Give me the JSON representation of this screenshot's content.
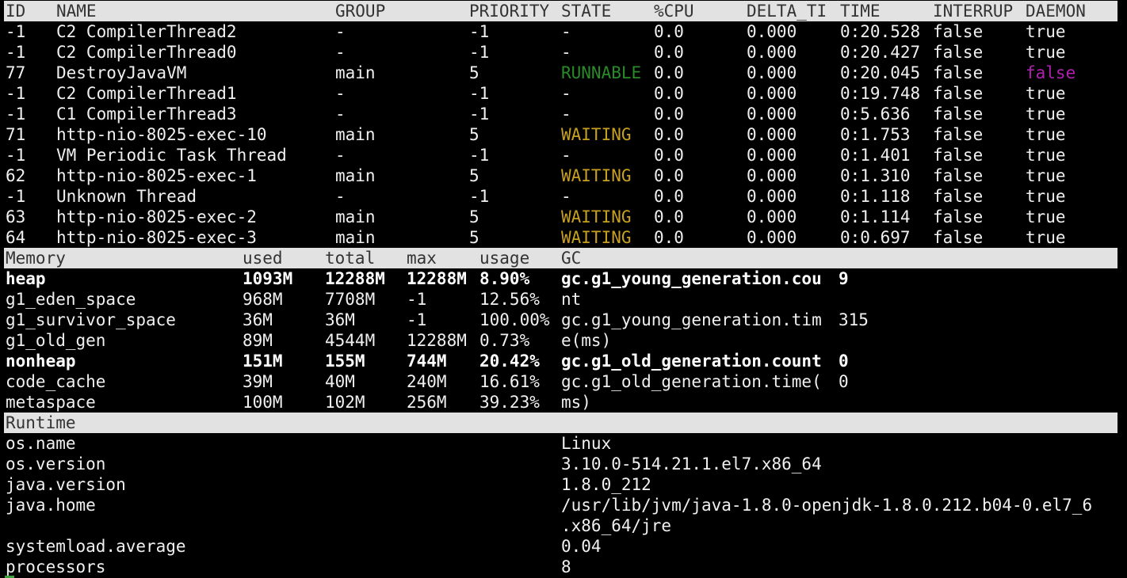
{
  "threads": {
    "headers": [
      "ID",
      "NAME",
      "GROUP",
      "PRIORITY",
      "STATE",
      "%CPU",
      "DELTA_TI",
      "TIME",
      "INTERRUP",
      "DAEMON"
    ],
    "rows": [
      [
        "-1",
        "C2 CompilerThread2",
        "-",
        "-1",
        "-",
        "0.0",
        "0.000",
        "0:20.528",
        "false",
        "true"
      ],
      [
        "-1",
        "C2 CompilerThread0",
        "-",
        "-1",
        "-",
        "0.0",
        "0.000",
        "0:20.427",
        "false",
        "true"
      ],
      [
        "77",
        "DestroyJavaVM",
        "main",
        "5",
        "RUNNABLE",
        "0.0",
        "0.000",
        "0:20.045",
        "false",
        "false"
      ],
      [
        "-1",
        "C2 CompilerThread1",
        "-",
        "-1",
        "-",
        "0.0",
        "0.000",
        "0:19.748",
        "false",
        "true"
      ],
      [
        "-1",
        "C1 CompilerThread3",
        "-",
        "-1",
        "-",
        "0.0",
        "0.000",
        "0:5.636",
        "false",
        "true"
      ],
      [
        "71",
        "http-nio-8025-exec-10",
        "main",
        "5",
        "WAITING",
        "0.0",
        "0.000",
        "0:1.753",
        "false",
        "true"
      ],
      [
        "-1",
        "VM Periodic Task Thread",
        "-",
        "-1",
        "-",
        "0.0",
        "0.000",
        "0:1.401",
        "false",
        "true"
      ],
      [
        "62",
        "http-nio-8025-exec-1",
        "main",
        "5",
        "WAITING",
        "0.0",
        "0.000",
        "0:1.310",
        "false",
        "true"
      ],
      [
        "-1",
        "Unknown Thread",
        "-",
        "-1",
        "-",
        "0.0",
        "0.000",
        "0:1.118",
        "false",
        "true"
      ],
      [
        "63",
        "http-nio-8025-exec-2",
        "main",
        "5",
        "WAITING",
        "0.0",
        "0.000",
        "0:1.114",
        "false",
        "true"
      ],
      [
        "64",
        "http-nio-8025-exec-3",
        "main",
        "5",
        "WAITING",
        "0.0",
        "0.000",
        "0:0.697",
        "false",
        "true"
      ]
    ]
  },
  "memory": {
    "headers": [
      "Memory",
      "used",
      "total",
      "max",
      "usage",
      "GC"
    ],
    "rows": [
      {
        "cells": [
          "heap",
          "1093M",
          "12288M",
          "12288M",
          "8.90%",
          "gc.g1_young_generation.cou",
          "9"
        ],
        "bold": true
      },
      {
        "cells": [
          "g1_eden_space",
          "968M",
          "7708M",
          "-1",
          "12.56%",
          "nt",
          ""
        ],
        "bold": false
      },
      {
        "cells": [
          "g1_survivor_space",
          "36M",
          "36M",
          "-1",
          "100.00%",
          "gc.g1_young_generation.tim",
          "315"
        ],
        "bold": false
      },
      {
        "cells": [
          "g1_old_gen",
          "89M",
          "4544M",
          "12288M",
          "0.73%",
          "e(ms)",
          ""
        ],
        "bold": false
      },
      {
        "cells": [
          "nonheap",
          "151M",
          "155M",
          "744M",
          "20.42%",
          "gc.g1_old_generation.count",
          "0"
        ],
        "bold": true
      },
      {
        "cells": [
          "code_cache",
          "39M",
          "40M",
          "240M",
          "16.61%",
          "gc.g1_old_generation.time(",
          "0"
        ],
        "bold": false
      },
      {
        "cells": [
          "metaspace",
          "100M",
          "102M",
          "256M",
          "39.23%",
          "ms)",
          ""
        ],
        "bold": false
      }
    ]
  },
  "runtime": {
    "header": "Runtime",
    "rows": [
      [
        "os.name",
        "Linux"
      ],
      [
        "os.version",
        "3.10.0-514.21.1.el7.x86_64"
      ],
      [
        "java.version",
        "1.8.0_212"
      ],
      [
        "java.home",
        "/usr/lib/jvm/java-1.8.0-openjdk-1.8.0.212.b04-0.el7_6"
      ],
      [
        "",
        ".x86_64/jre"
      ],
      [
        "systemload.average",
        "0.04"
      ],
      [
        "processors",
        "8"
      ]
    ]
  }
}
